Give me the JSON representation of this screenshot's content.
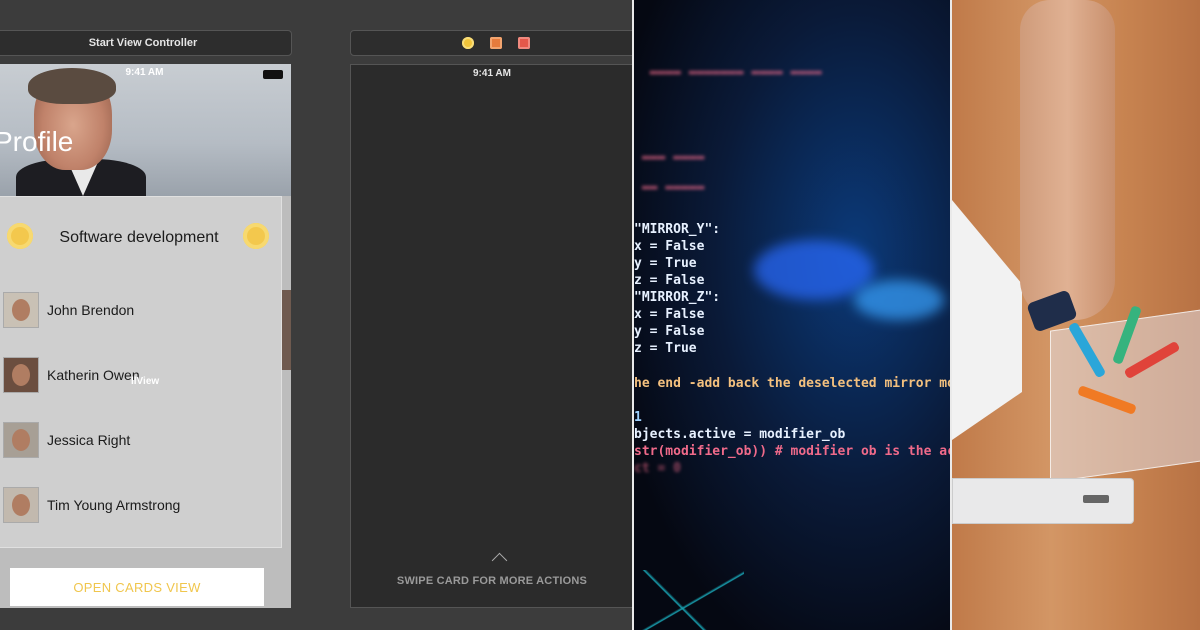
{
  "storyboard": {
    "left_scene_title": "Start View Controller",
    "right_scene_icons": [
      "first-responder-icon",
      "view-controller-icon",
      "exit-icon"
    ]
  },
  "left_phone": {
    "status_time": "9:41 AM",
    "header_title": "Profile",
    "card_title": "Software development",
    "people": [
      {
        "name": "John Brendon"
      },
      {
        "name": "Katherin Owen"
      },
      {
        "name": "Jessica Right"
      },
      {
        "name": "Tim Young Armstrong"
      }
    ],
    "overlay_label": "llView",
    "open_button_label": "OPEN CARDS VIEW"
  },
  "right_phone": {
    "status_time": "9:41 AM",
    "swipe_hint": "SWIPE CARD FOR MORE ACTIONS"
  },
  "code_panel": {
    "lines": [
      "\"MIRROR_Y\":",
      "x = False",
      "y = True",
      "z = False",
      "\"MIRROR_Z\":",
      "x = False",
      "y = False",
      "z = True",
      "he end -add back the deselected mirror mo",
      "1",
      "bjects.active = modifier_ob",
      "str(modifier_ob)) # modifier ob is the ac",
      "ct = 0"
    ]
  },
  "colors": {
    "accent_yellow": "#f0c64d",
    "card_bg": "#cfcfcf",
    "code_orange": "#f3c07e",
    "code_white": "#e7f1ff"
  }
}
